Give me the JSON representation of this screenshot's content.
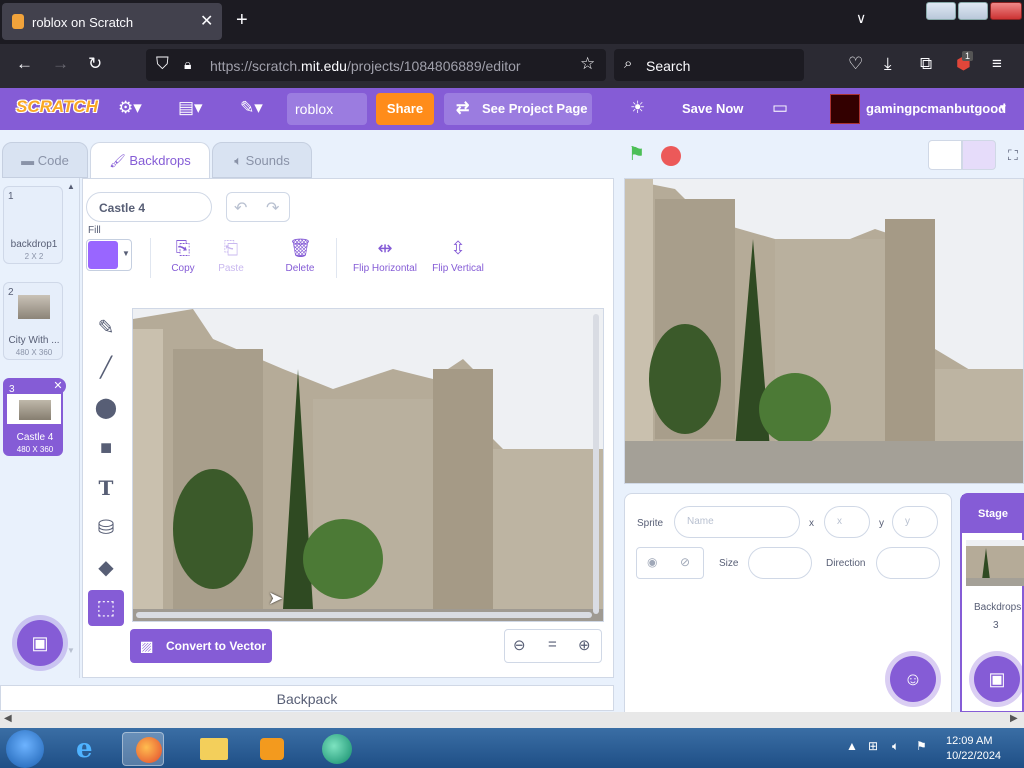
{
  "browser": {
    "tab_title": "roblox on Scratch",
    "url_prefix": "https://scratch.",
    "url_domain": "mit.edu",
    "url_path": "/projects/1084806889/editor",
    "search_placeholder": "Search",
    "extension_badge": "1"
  },
  "menubar": {
    "logo": "SCRATCH",
    "project_title": "roblox",
    "share_label": "Share",
    "see_project_label": "See Project Page",
    "save_now_label": "Save Now",
    "username": "gamingpcmanbutgood"
  },
  "tabs": {
    "code": "Code",
    "backdrops": "Backdrops",
    "sounds": "Sounds"
  },
  "backdrops": [
    {
      "num": "1",
      "name": "backdrop1",
      "size": "2 X 2"
    },
    {
      "num": "2",
      "name": "City With ...",
      "size": "480 X 360"
    },
    {
      "num": "3",
      "name": "Castle 4",
      "size": "480 X 360"
    }
  ],
  "paint": {
    "costume_name": "Castle 4",
    "fill_label": "Fill",
    "fill_color": "#9966ff",
    "copy_label": "Copy",
    "paste_label": "Paste",
    "delete_label": "Delete",
    "flip_h_label": "Flip Horizontal",
    "flip_v_label": "Flip Vertical",
    "convert_label": "Convert to Vector",
    "zoom_reset": "="
  },
  "backpack_label": "Backpack",
  "sprite_info": {
    "sprite_label": "Sprite",
    "name_placeholder": "Name",
    "x_label": "x",
    "x_placeholder": "x",
    "y_label": "y",
    "y_placeholder": "y",
    "size_label": "Size",
    "direction_label": "Direction"
  },
  "stage_panel": {
    "header": "Stage",
    "backdrops_label": "Backdrops",
    "backdrops_count": "3"
  },
  "taskbar": {
    "time": "12:09 AM",
    "date": "10/22/2024"
  },
  "colors": {
    "accent": "#855cd6",
    "share": "#ff8c1a",
    "flag": "#4cbf56",
    "stop": "#ec5959"
  }
}
